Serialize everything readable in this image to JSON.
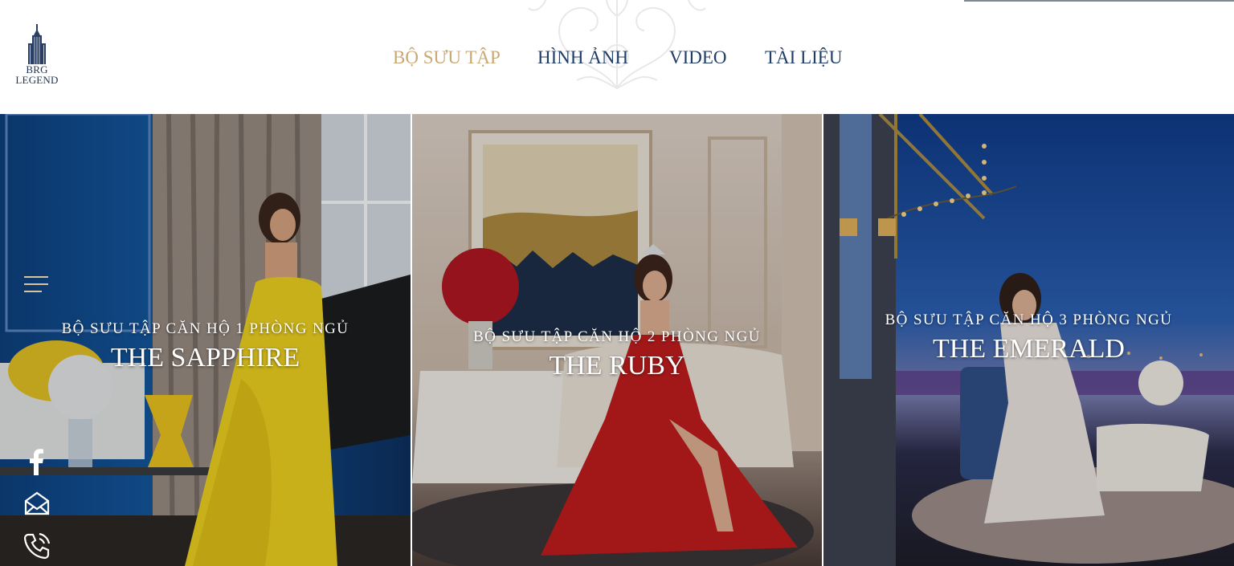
{
  "header": {
    "logo": {
      "line1": "BRG",
      "line2": "LEGEND"
    },
    "nav": [
      {
        "label": "BỘ SƯU TẬP",
        "active": true
      },
      {
        "label": "HÌNH ẢNH",
        "active": false
      },
      {
        "label": "VIDEO",
        "active": false
      },
      {
        "label": "TÀI LIỆU",
        "active": false
      }
    ]
  },
  "panels": [
    {
      "subtitle": "BỘ SƯU TẬP CĂN HỘ 1 PHÒNG NGỦ",
      "title": "THE SAPPHIRE",
      "theme_color": "#0f4b8c",
      "gown_color": "#f2d31b"
    },
    {
      "subtitle": "BỘ SƯU TẬP CĂN HỘ 2 PHÒNG NGỦ",
      "title": "THE RUBY",
      "theme_color": "#e9ded4",
      "gown_color": "#c41a1a"
    },
    {
      "subtitle": "BỘ SƯU TẬP CĂN HỘ 3 PHÒNG NGỦ",
      "title": "THE EMERALD",
      "theme_color": "#1b3f7a",
      "gown_color": "#f1e8e2"
    }
  ],
  "side_icons": [
    "facebook-icon",
    "mail-icon",
    "phone-icon"
  ],
  "colors": {
    "accent": "#c8a873",
    "nav": "#1f3d66"
  }
}
